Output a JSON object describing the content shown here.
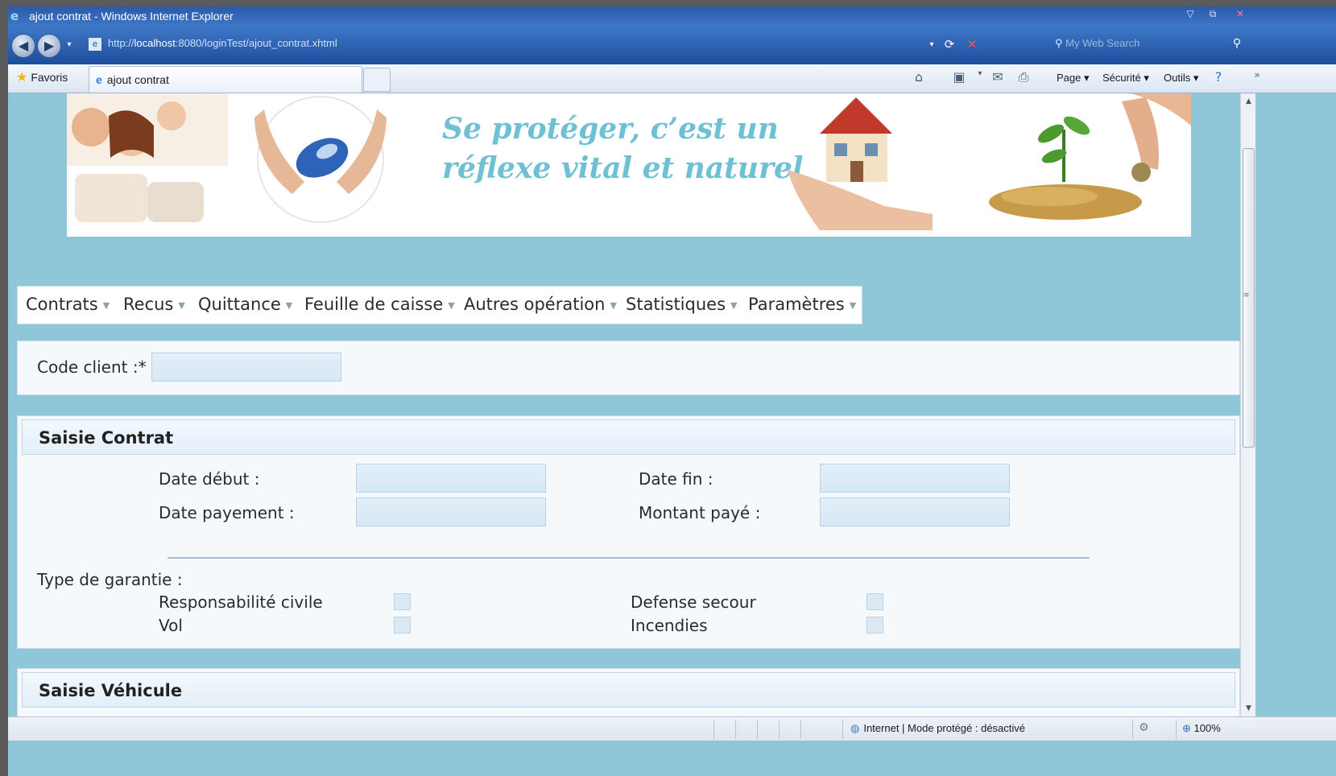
{
  "browser": {
    "window_title": "ajout contrat - Windows Internet Explorer",
    "address": {
      "prefix": "http://",
      "host": "localhost",
      "path": ":8080/loginTest/ajout_contrat.xhtml"
    },
    "search_placeholder": "My Web Search",
    "favorites_label": "Favoris",
    "tab_label": "ajout contrat",
    "commands": {
      "page": "Page",
      "security": "Sécurité",
      "tools": "Outils"
    },
    "status_zone": "Internet | Mode protégé : désactivé",
    "zoom": "100%"
  },
  "banner": {
    "slogan_line1": "Se protéger, c’est un",
    "slogan_line2": "réflexe vital et naturel",
    "slogan_color": "#6ec0d4"
  },
  "menu": {
    "items": [
      {
        "label": "Contrats"
      },
      {
        "label": "Recus"
      },
      {
        "label": "Quittance"
      },
      {
        "label": "Feuille de caisse"
      },
      {
        "label": "Autres opération"
      },
      {
        "label": "Statistiques"
      },
      {
        "label": "Paramètres"
      }
    ]
  },
  "client": {
    "code_label": "Code client :*",
    "code_value": ""
  },
  "contract": {
    "title": "Saisie Contrat",
    "date_start_label": "Date début :",
    "date_end_label": "Date fin :",
    "payment_date_label": "Date payement :",
    "amount_paid_label": "Montant payé :",
    "guarantee_type_label": "Type de garantie :",
    "guarantees": {
      "civil_liability": "Responsabilité civile",
      "defense": "Defense secour",
      "theft": "Vol",
      "fire": "Incendies"
    }
  },
  "vehicle": {
    "title": "Saisie Véhicule"
  },
  "colors": {
    "page_bg": "#8fc6d8",
    "title_bar": "#2a5aa8",
    "panel_bg": "#f5f9fc"
  }
}
